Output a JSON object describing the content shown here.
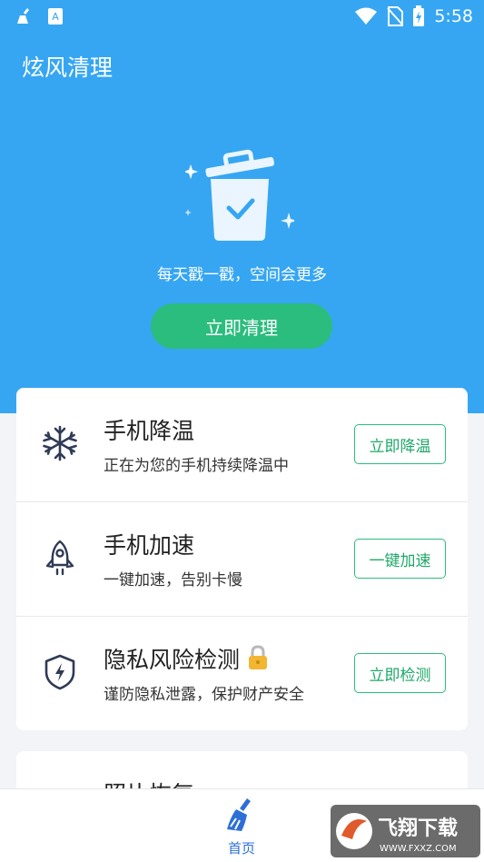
{
  "statusbar": {
    "time": "5:58"
  },
  "app": {
    "title": "炫风清理"
  },
  "hero": {
    "slogan": "每天戳一戳，空间会更多",
    "clean_button": "立即清理"
  },
  "features": [
    {
      "title": "手机降温",
      "subtitle": "正在为您的手机持续降温中",
      "button": "立即降温",
      "icon": "snowflake-icon"
    },
    {
      "title": "手机加速",
      "subtitle": "一键加速，告别卡慢",
      "button": "一键加速",
      "icon": "rocket-icon"
    },
    {
      "title": "隐私风险检测",
      "subtitle": "谨防隐私泄露，保护财产安全",
      "button": "立即检测",
      "icon": "shield-icon",
      "locked": true
    }
  ],
  "partial_card": {
    "title": "照片恢复"
  },
  "bottom_nav": {
    "home_label": "首页"
  },
  "watermark": {
    "line1": "飞翔下载",
    "line2": "WWW.FXXZ.COM"
  },
  "colors": {
    "primary": "#36a6f2",
    "accent": "#2bbd7e",
    "nav_active": "#2d6fd6"
  }
}
